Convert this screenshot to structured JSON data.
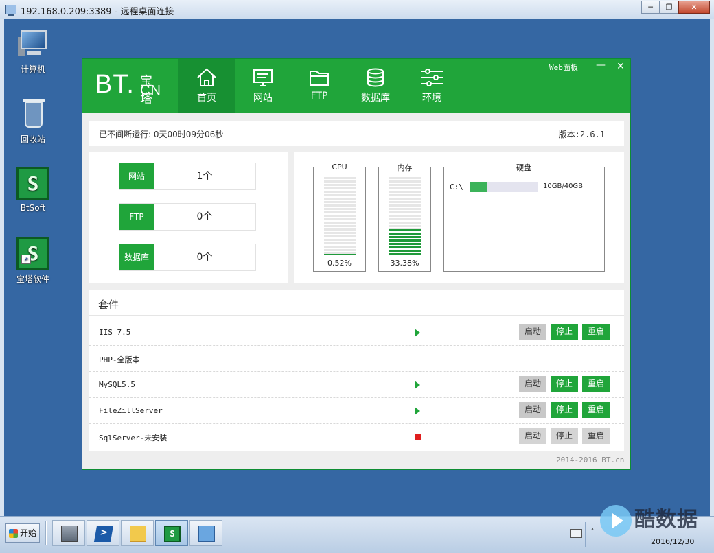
{
  "rdp": {
    "title": "192.168.0.209:3389 - 远程桌面连接",
    "min_icon": "minimize-glyph",
    "restore_icon": "restore-glyph",
    "close_icon": "close-glyph"
  },
  "desktop_icons": [
    {
      "label": "计算机",
      "icon": "computer-icon"
    },
    {
      "label": "回收站",
      "icon": "recycle-bin-icon"
    },
    {
      "label": "BtSoft",
      "icon": "btsoft-icon",
      "glyph": "S"
    },
    {
      "label": "宝塔软件",
      "icon": "bt-software-shortcut-icon",
      "glyph": "S"
    }
  ],
  "bt": {
    "logo": {
      "main": "BT.",
      "cn_top": "宝塔",
      "cn_bottom": "CN"
    },
    "nav": [
      {
        "label": "首页",
        "icon": "home-icon",
        "active": true
      },
      {
        "label": "网站",
        "icon": "monitor-icon",
        "active": false
      },
      {
        "label": "FTP",
        "icon": "folder-icon",
        "active": false
      },
      {
        "label": "数据库",
        "icon": "database-icon",
        "active": false
      },
      {
        "label": "环境",
        "icon": "sliders-icon",
        "active": false
      }
    ],
    "web_panel": "Web面板",
    "min_glyph": "—",
    "close_glyph": "✕",
    "uptime": "已不间断运行: 0天00时09分06秒",
    "version": "版本:2.6.1",
    "stats": [
      {
        "tag": "网站",
        "value": "1个"
      },
      {
        "tag": "FTP",
        "value": "0个"
      },
      {
        "tag": "数据库",
        "value": "0个"
      }
    ],
    "cpu": {
      "title": "CPU",
      "percent_label": "0.52%",
      "fill_fraction": 0.0052
    },
    "memory": {
      "title": "内存",
      "percent_label": "33.38%",
      "fill_fraction": 0.3338
    },
    "disk": {
      "title": "硬盘",
      "drive": "C:\\",
      "usage": "10GB/40GB",
      "fill_fraction": 0.25
    },
    "suite": {
      "title": "套件",
      "rows": [
        {
          "name": "IIS 7.5",
          "status": "running",
          "buttons": [
            "启动",
            "停止",
            "重启"
          ]
        },
        {
          "name": "PHP-全版本",
          "status": "none",
          "buttons": []
        },
        {
          "name": "MySQL5.5",
          "status": "running",
          "buttons": [
            "启动",
            "停止",
            "重启"
          ]
        },
        {
          "name": "FileZillServer",
          "status": "running",
          "buttons": [
            "启动",
            "停止",
            "重启"
          ]
        },
        {
          "name": "SqlServer-未安装",
          "status": "stopped",
          "buttons": [
            "启动",
            "停止",
            "重启"
          ]
        }
      ]
    },
    "copyright": "2014-2016 BT.cn",
    "colors": {
      "brand_green": "#20a53a",
      "stopped_red": "#e01e1e"
    }
  },
  "taskbar": {
    "start_label": "开始",
    "items": [
      "server-manager-icon",
      "powershell-icon",
      "explorer-folder-icon",
      "btsoft-taskbar-icon",
      "control-panel-icon"
    ],
    "clock_date": "2016/12/30"
  },
  "watermark": {
    "text": "酷数据"
  }
}
